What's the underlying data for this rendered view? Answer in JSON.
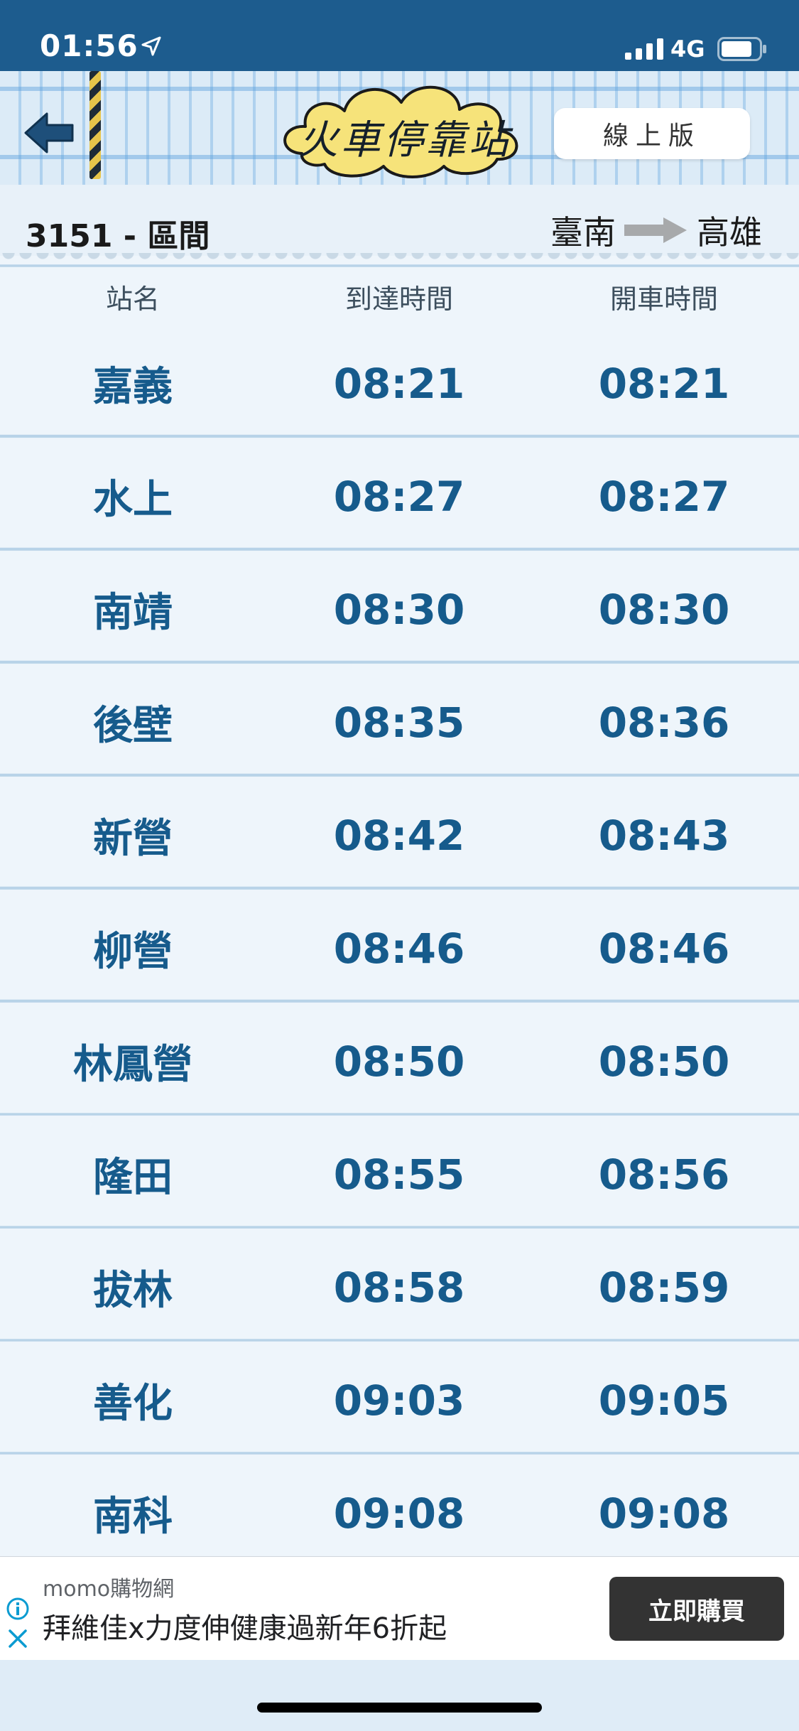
{
  "status_bar": {
    "time": "01:56",
    "network": "4G"
  },
  "header": {
    "logo_text": "火車停靠站",
    "online_button": "線上版"
  },
  "train": {
    "id_label": "3151 - 區間",
    "from": "臺南",
    "to": "高雄"
  },
  "columns": {
    "station": "站名",
    "arrival": "到達時間",
    "departure": "開車時間"
  },
  "stops": [
    {
      "station": "嘉義",
      "arrival": "08:21",
      "departure": "08:21"
    },
    {
      "station": "水上",
      "arrival": "08:27",
      "departure": "08:27"
    },
    {
      "station": "南靖",
      "arrival": "08:30",
      "departure": "08:30"
    },
    {
      "station": "後壁",
      "arrival": "08:35",
      "departure": "08:36"
    },
    {
      "station": "新營",
      "arrival": "08:42",
      "departure": "08:43"
    },
    {
      "station": "柳營",
      "arrival": "08:46",
      "departure": "08:46"
    },
    {
      "station": "林鳳營",
      "arrival": "08:50",
      "departure": "08:50"
    },
    {
      "station": "隆田",
      "arrival": "08:55",
      "departure": "08:56"
    },
    {
      "station": "拔林",
      "arrival": "08:58",
      "departure": "08:59"
    },
    {
      "station": "善化",
      "arrival": "09:03",
      "departure": "09:05"
    },
    {
      "station": "南科",
      "arrival": "09:08",
      "departure": "09:08"
    }
  ],
  "ad": {
    "source": "momo購物網",
    "text": "拜維佳x力度伸健康過新年6折起",
    "button": "立即購買"
  },
  "colors": {
    "status_bar": "#1d5c8e",
    "time_text": "#165b8c",
    "row_line": "#b8d3e8"
  }
}
